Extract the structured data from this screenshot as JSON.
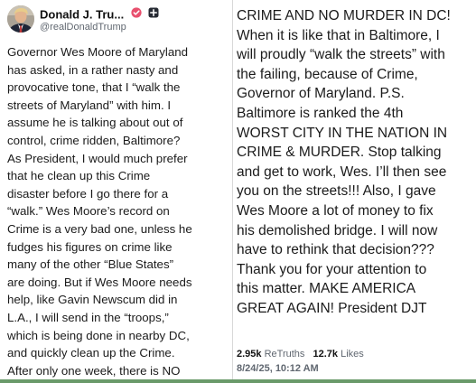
{
  "post": {
    "author": {
      "display_name": "Donald J. Tru...",
      "handle": "@realDonaldTrump",
      "avatar_icon": "profile-avatar"
    },
    "text_left_lines": [
      "Governor Wes Moore of Maryland",
      "has asked, in a rather nasty and",
      "provocative tone, that I “walk the",
      "streets of Maryland” with him. I",
      "assume he is talking about out of",
      "control, crime ridden, Baltimore?",
      "As President, I would much prefer",
      "that he clean up this Crime",
      "disaster before I go there for a",
      "“walk.” Wes Moore’s record on",
      "Crime is a very bad one, unless he",
      "fudges his figures on crime like",
      "many of the other “Blue States”",
      "are doing. But if Wes Moore needs",
      "help, like Gavin Newscum did in",
      "L.A., I will send in the “troops,”",
      "which is being done in nearby DC,",
      "and quickly clean up the Crime.",
      "After only one week, there is NO"
    ],
    "text_right_lines": [
      "CRIME AND NO MURDER IN DC!",
      "When it is like that in Baltimore, I",
      "will proudly “walk the streets” with",
      "the failing, because of Crime,",
      "Governor of Maryland. P.S.",
      "Baltimore is ranked the 4th",
      "WORST CITY IN THE NATION IN",
      "CRIME & MURDER. Stop talking",
      "and get to work, Wes. I’ll then see",
      "you on the streets!!! Also, I gave",
      "Wes Moore a lot of money to fix",
      "his demolished bridge. I will now",
      "have to rethink that decision???",
      "Thank you for your attention to",
      "this matter. MAKE AMERICA",
      "GREAT AGAIN! President DJT"
    ],
    "stats": {
      "retruths_count": "2.95k",
      "retruths_label": "ReTruths",
      "likes_count": "12.7k",
      "likes_label": "Likes"
    },
    "timestamp": "8/24/25, 10:12 AM"
  },
  "colors": {
    "verified_badge": "#e8506e",
    "text": "#1b1b1b",
    "muted": "#606770"
  }
}
